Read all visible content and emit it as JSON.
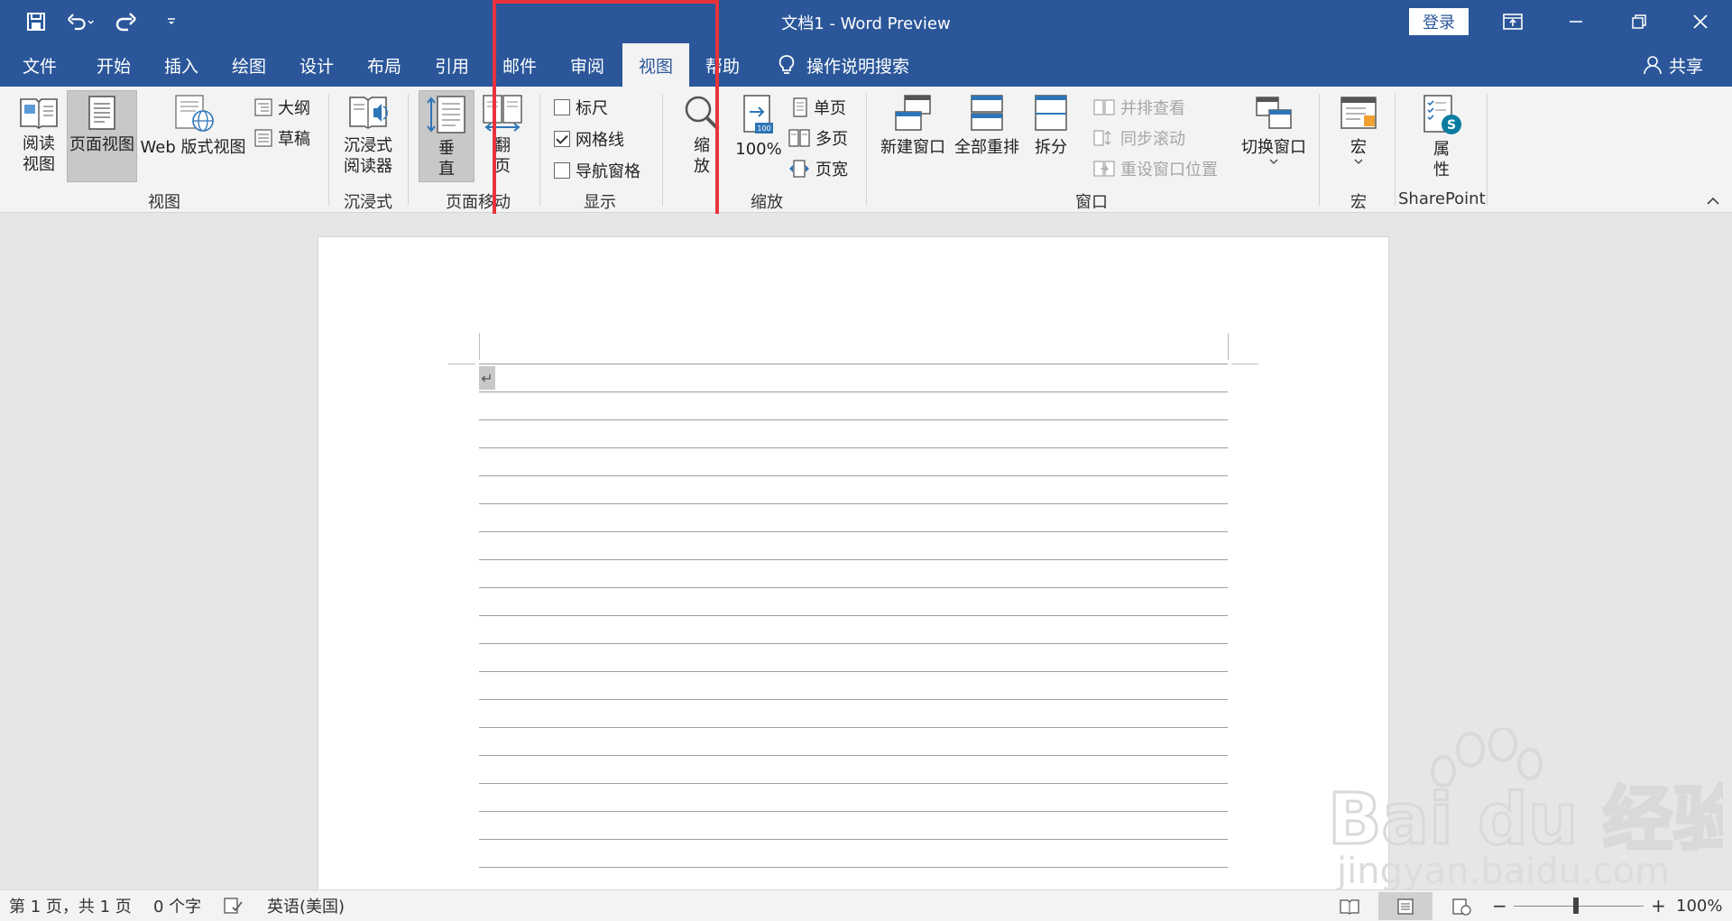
{
  "window": {
    "title": "文档1  -  Word Preview",
    "login_label": "登录"
  },
  "tabs": [
    {
      "label": "文件"
    },
    {
      "label": "开始"
    },
    {
      "label": "插入"
    },
    {
      "label": "绘图"
    },
    {
      "label": "设计"
    },
    {
      "label": "布局"
    },
    {
      "label": "引用"
    },
    {
      "label": "邮件"
    },
    {
      "label": "审阅"
    },
    {
      "label": "视图",
      "active": true
    },
    {
      "label": "帮助"
    }
  ],
  "tell_me": "操作说明搜索",
  "share_label": "共享",
  "ribbon": {
    "views": {
      "label": "视图",
      "read_line1": "阅读",
      "read_line2": "视图",
      "print_layout": "页面视图",
      "web_layout": "Web 版式视图",
      "outline": "大纲",
      "draft": "草稿"
    },
    "immersive": {
      "label": "沉浸式",
      "reader_line1": "沉浸式",
      "reader_line2": "阅读器"
    },
    "page_movement": {
      "label": "页面移动",
      "vertical_line1": "垂",
      "vertical_line2": "直",
      "side_line1": "翻",
      "side_line2": "页"
    },
    "show": {
      "label": "显示",
      "ruler": "标尺",
      "gridlines": "网格线",
      "nav_pane": "导航窗格",
      "ruler_checked": false,
      "gridlines_checked": true,
      "nav_pane_checked": false
    },
    "zoom": {
      "label": "缩放",
      "zoom_line1": "缩",
      "zoom_line2": "放",
      "hundred": "100%",
      "one_page": "单页",
      "multi_page": "多页",
      "page_width": "页宽"
    },
    "window": {
      "label": "窗口",
      "new_window": "新建窗口",
      "arrange_all": "全部重排",
      "split": "拆分",
      "side_by_side": "并排查看",
      "sync_scroll": "同步滚动",
      "reset_pos": "重设窗口位置",
      "switch_windows": "切换窗口"
    },
    "macros": {
      "label": "宏",
      "macros_btn": "宏"
    },
    "sharepoint": {
      "label": "SharePoint",
      "props_line1": "属",
      "props_line2": "性"
    }
  },
  "document": {
    "para_mark": "↵",
    "gridline_count": 18
  },
  "statusbar": {
    "page": "第 1 页，共 1 页",
    "words": "0 个字",
    "language": "英语(美国)",
    "zoom": "100%",
    "zoom_minus": "−",
    "zoom_plus": "+"
  },
  "watermark": {
    "brand": "Bai du 经验",
    "url": "jingyan.baidu.com"
  },
  "colors": {
    "accent": "#2b579a",
    "highlight": "#e8333c"
  }
}
